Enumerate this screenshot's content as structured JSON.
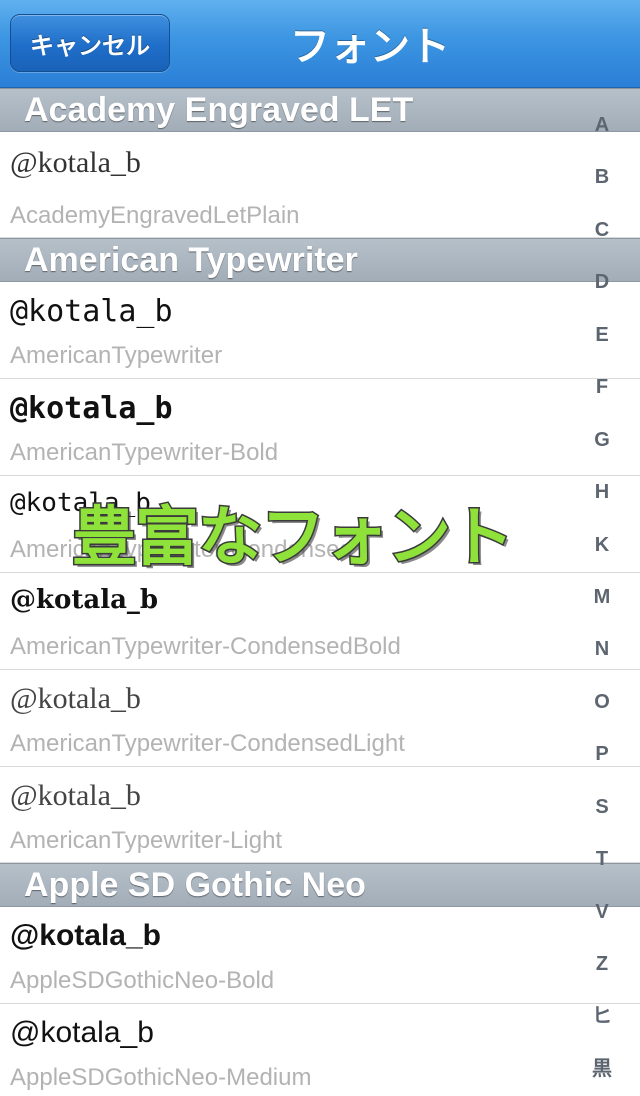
{
  "navbar": {
    "cancel_label": "キャンセル",
    "title": "フォント"
  },
  "sections": [
    {
      "header": "Academy Engraved LET",
      "rows": [
        {
          "sample": "@kotala_b",
          "font_name": "AcademyEngravedLetPlain"
        }
      ]
    },
    {
      "header": "American Typewriter",
      "rows": [
        {
          "sample": "@kotala_b",
          "font_name": "AmericanTypewriter"
        },
        {
          "sample": "@kotala_b",
          "font_name": "AmericanTypewriter-Bold"
        },
        {
          "sample": "@kotala_b",
          "font_name": "AmericanTypewriter-Condensed"
        },
        {
          "sample": "@kotala_b",
          "font_name": "AmericanTypewriter-CondensedBold"
        },
        {
          "sample": "@kotala_b",
          "font_name": "AmericanTypewriter-CondensedLight"
        },
        {
          "sample": "@kotala_b",
          "font_name": "AmericanTypewriter-Light"
        }
      ]
    },
    {
      "header": "Apple SD Gothic Neo",
      "rows": [
        {
          "sample": "@kotala_b",
          "font_name": "AppleSDGothicNeo-Bold"
        },
        {
          "sample": "@kotala_b",
          "font_name": "AppleSDGothicNeo-Medium"
        }
      ]
    }
  ],
  "index": [
    "A",
    "B",
    "C",
    "D",
    "E",
    "F",
    "G",
    "H",
    "K",
    "M",
    "N",
    "O",
    "P",
    "S",
    "T",
    "V",
    "Z",
    "ヒ",
    "黒"
  ],
  "overlay": {
    "promo_text": "豊富なフォント"
  },
  "colors": {
    "navbar": "#3c95e2",
    "section_header": "#a9b4be",
    "promo_fill": "#8ee23a",
    "subtitle_gray": "#b3b3b3"
  }
}
